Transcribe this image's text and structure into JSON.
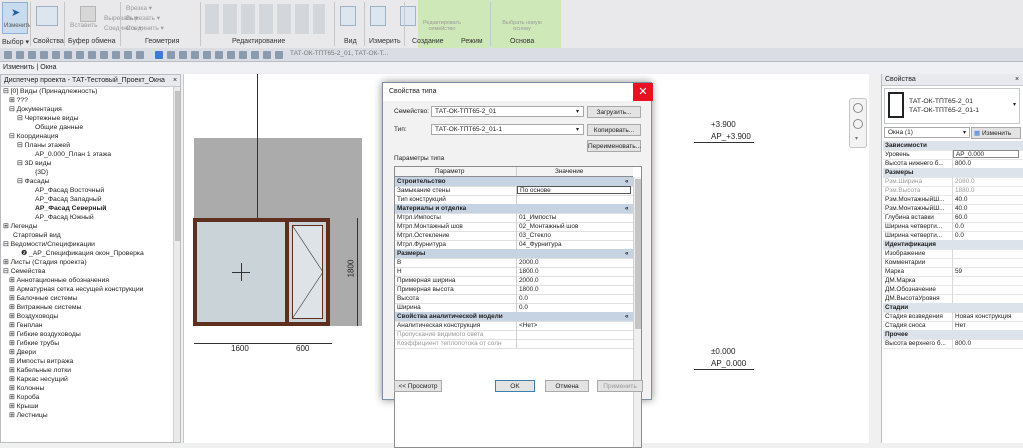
{
  "ribbon": {
    "modify_label": "Изменить",
    "groups": [
      {
        "label": "Выбор ▾"
      },
      {
        "label": "Свойства"
      },
      {
        "label": "Буфер обмена"
      },
      {
        "label": "Геометрия"
      },
      {
        "label": "Редактирование"
      },
      {
        "label": "Вид"
      },
      {
        "label": "Измерить"
      },
      {
        "label": "Создание"
      },
      {
        "label": "Режим"
      },
      {
        "label": "Основа"
      }
    ],
    "clipboard": {
      "paste": "Вставить",
      "cut": "Вырезать ▾",
      "join": "Соединить ▾"
    },
    "geometry": {
      "cut": "Врезка ▾",
      "cut2": "Вырезать ▾",
      "join": "Соединить ▾"
    },
    "mode": {
      "edit_family": "Редактировать семейство"
    },
    "host": {
      "pick_new_host": "Выбрать новую основу"
    }
  },
  "view_tab": {
    "label": "ТАТ-ОК-ТПТ65-2_01, ТАТ-ОК-Т..."
  },
  "options_bar": {
    "label": "Изменить | Окна"
  },
  "project_browser": {
    "title": "Диспетчер проекта - ТАТ-Тестовый_Проект_Окна",
    "close": "×",
    "items": [
      {
        "text": "⊟ [0] Виды (Принадлежность)"
      },
      {
        "text": "⊞ ???"
      },
      {
        "text": "⊟ Документация"
      },
      {
        "text": "⊟ Чертежные виды"
      },
      {
        "text": "Общие данные"
      },
      {
        "text": "⊟ Координация"
      },
      {
        "text": "⊟ Планы этажей"
      },
      {
        "text": "АР_0.000_План 1 этажа"
      },
      {
        "text": "⊟ 3D виды"
      },
      {
        "text": "{3D}"
      },
      {
        "text": "⊟ Фасады"
      },
      {
        "text": "АР_Фасад Восточный"
      },
      {
        "text": "АР_Фасад Западный"
      },
      {
        "text": "АР_Фасад Северный"
      },
      {
        "text": "АР_Фасад Южный"
      },
      {
        "text": "⊞ Легенды"
      },
      {
        "text": "Стартовый вид"
      },
      {
        "text": "⊟ Ведомости/Спецификации"
      },
      {
        "text": "❷ _АР_Спецификация окон_Проверка"
      },
      {
        "text": "⊞ Листы (Стадия проекта)"
      },
      {
        "text": "⊟ Семейства"
      },
      {
        "text": "⊞ Аннотационные обозначения"
      },
      {
        "text": "⊞ Арматурная сетка несущей конструкции"
      },
      {
        "text": "⊞ Балочные системы"
      },
      {
        "text": "⊞ Витражные системы"
      },
      {
        "text": "⊞ Воздуховоды"
      },
      {
        "text": "⊞ Генплан"
      },
      {
        "text": "⊞ Гибкие воздуховоды"
      },
      {
        "text": "⊞ Гибкие трубы"
      },
      {
        "text": "⊞ Двери"
      },
      {
        "text": "⊞ Импосты витража"
      },
      {
        "text": "⊞ Кабельные лотки"
      },
      {
        "text": "⊞ Каркас несущий"
      },
      {
        "text": "⊞ Колонны"
      },
      {
        "text": "⊞ Короба"
      },
      {
        "text": "⊞ Крыши"
      },
      {
        "text": "⊞ Лестницы"
      }
    ]
  },
  "drawing": {
    "level_top_value": "+3.900",
    "level_top_name": "АР_+3.900",
    "level_bottom_value": "±0.000",
    "level_bottom_name": "АР_0.000",
    "dim_height": "1800",
    "dim_left": "1600",
    "dim_right": "600"
  },
  "type_dialog": {
    "title": "Свойства типа",
    "close": "✕",
    "family_label": "Семейство:",
    "family_value": "ТАТ-ОК-ТПТ65-2_01",
    "type_label": "Тип:",
    "type_value": "ТАТ-ОК-ТПТ65-2_01-1",
    "load_button": "Загрузить...",
    "copy_button": "Копировать...",
    "rename_button": "Переименовать...",
    "params_caption": "Параметры типа",
    "col_param": "Параметр",
    "col_value": "Значение",
    "rows": [
      {
        "p": "Строительство",
        "v": "",
        "hdr": true
      },
      {
        "p": "Замыкание стены",
        "v": "По основе"
      },
      {
        "p": "Тип конструкций",
        "v": ""
      },
      {
        "p": "Материалы и отделка",
        "v": "",
        "hdr": true
      },
      {
        "p": "Мтрл.Импосты",
        "v": "01_Импосты"
      },
      {
        "p": "Мтрл.Монтажный шов",
        "v": "02_Монтажный шов"
      },
      {
        "p": "Мтрл.Остекление",
        "v": "03_Стекло"
      },
      {
        "p": "Мтрл.Фурнитура",
        "v": "04_Фурнитура"
      },
      {
        "p": "Размеры",
        "v": "",
        "hdr": true
      },
      {
        "p": "B",
        "v": "2000.0"
      },
      {
        "p": "H",
        "v": "1800.0"
      },
      {
        "p": "Примерная ширина",
        "v": "2000.0"
      },
      {
        "p": "Примерная высота",
        "v": "1800.0"
      },
      {
        "p": "Высота",
        "v": "0.0"
      },
      {
        "p": "Ширина",
        "v": "0.0"
      },
      {
        "p": "Свойства аналитической модели",
        "v": "",
        "hdr": true
      },
      {
        "p": "Аналитическая конструкция",
        "v": "<Нет>"
      },
      {
        "p": "Пропускание видимого света",
        "v": ""
      },
      {
        "p": "Коэффициент теплопотока от солн",
        "v": ""
      }
    ],
    "preview_button": "<< Просмотр",
    "ok_button": "OK",
    "cancel_button": "Отмена",
    "apply_button": "Применить"
  },
  "properties": {
    "title": "Свойства",
    "close": "×",
    "type_name_1": "ТАТ-ОК-ТПТ65-2_01",
    "type_name_2": "ТАТ-ОК-ТПТ65-2_01-1",
    "selector": "Окна (1)",
    "edit_type": "Изменить тип",
    "rows": [
      {
        "p": "Зависимости",
        "v": "",
        "hdr": true
      },
      {
        "p": "Уровень",
        "v": "АР_0.000"
      },
      {
        "p": "Высота нижнего б...",
        "v": "800.0"
      },
      {
        "p": "Размеры",
        "v": "",
        "hdr": true
      },
      {
        "p": "Рзм.Ширина",
        "v": "2080.0"
      },
      {
        "p": "Рзм.Высота",
        "v": "1880.0"
      },
      {
        "p": "Рзм.МонтажныйШ...",
        "v": "40.0"
      },
      {
        "p": "Рзм.МонтажныйШ...",
        "v": "40.0"
      },
      {
        "p": "Глубина вставки",
        "v": "60.0"
      },
      {
        "p": "Ширина четверти...",
        "v": "0.0"
      },
      {
        "p": "Ширина четверти...",
        "v": "0.0"
      },
      {
        "p": "Идентификация",
        "v": "",
        "hdr": true
      },
      {
        "p": "Изображение",
        "v": ""
      },
      {
        "p": "Комментарии",
        "v": ""
      },
      {
        "p": "Марка",
        "v": "59"
      },
      {
        "p": "ДМ.Марка",
        "v": ""
      },
      {
        "p": "ДМ.Обозначение",
        "v": ""
      },
      {
        "p": "ДМ.ВысотаУровня",
        "v": ""
      },
      {
        "p": "Стадии",
        "v": "",
        "hdr": true
      },
      {
        "p": "Стадия возведения",
        "v": "Новая конструкция"
      },
      {
        "p": "Стадия сноса",
        "v": "Нет"
      },
      {
        "p": "Прочее",
        "v": "",
        "hdr": true
      },
      {
        "p": "Высота верхнего б...",
        "v": "800.0"
      }
    ]
  }
}
